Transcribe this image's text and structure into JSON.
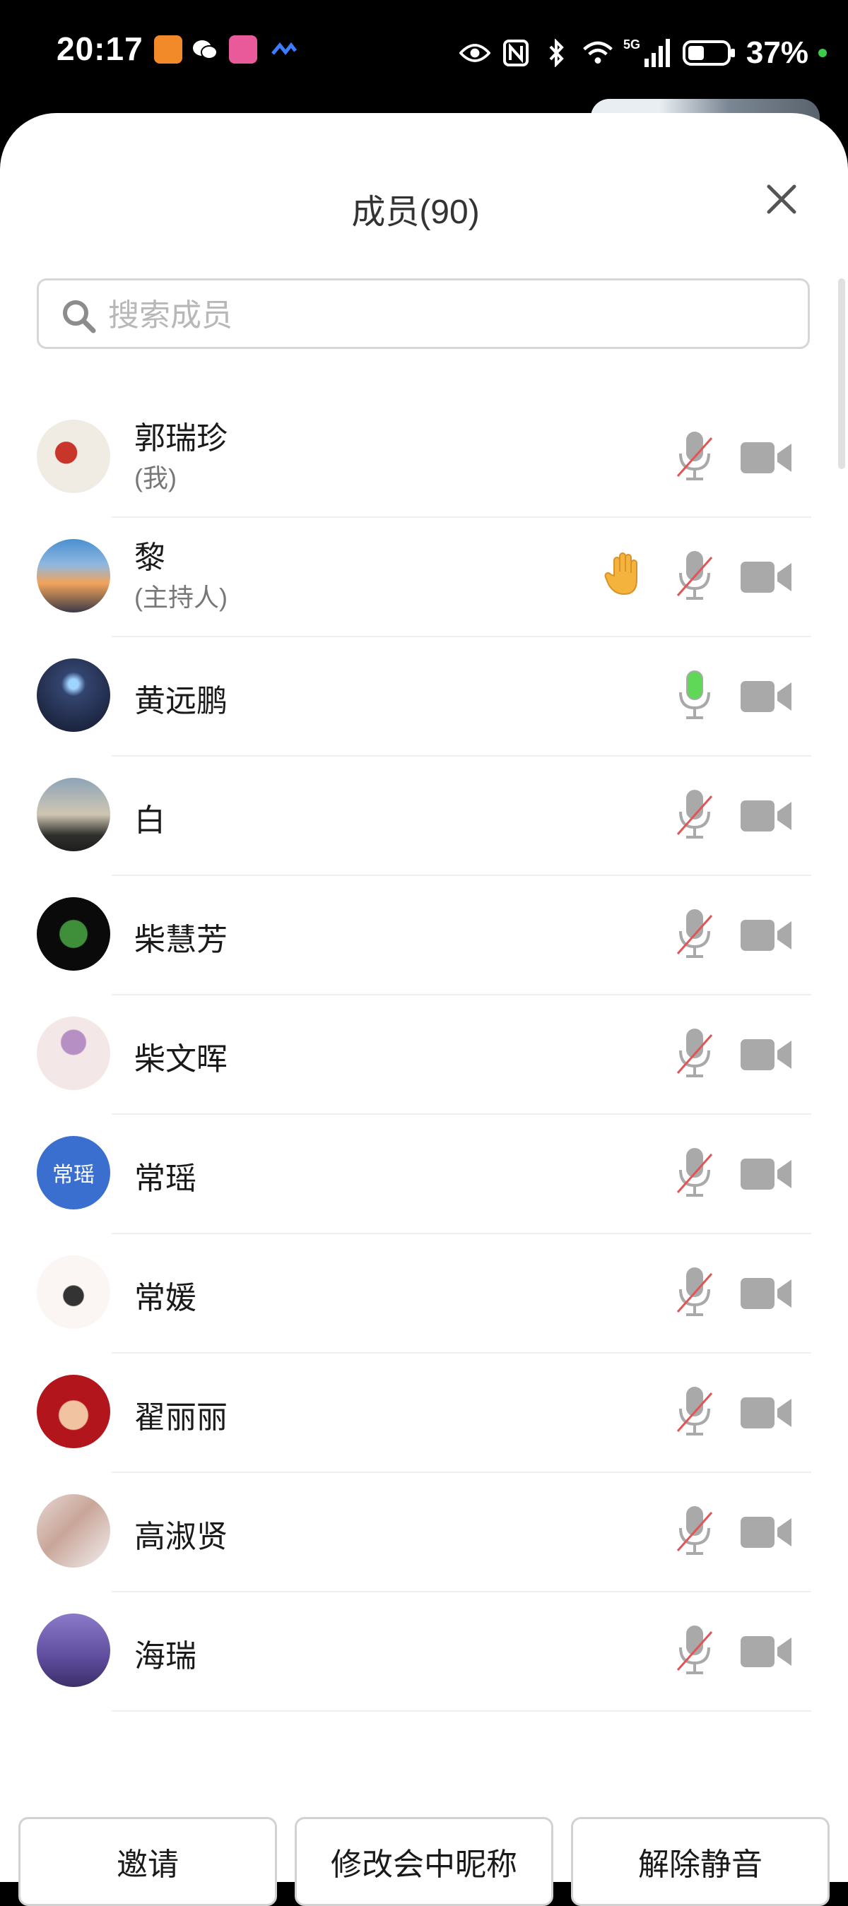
{
  "status_bar": {
    "time": "20:17",
    "network": "5G",
    "battery": "37%"
  },
  "header": {
    "title": "成员(90)"
  },
  "search": {
    "placeholder": "搜索成员"
  },
  "members": [
    {
      "name": "郭瑞珍",
      "role": "(我)",
      "mic": "muted",
      "hand_raised": false,
      "avatar": "photo-child"
    },
    {
      "name": "黎",
      "role": "(主持人)",
      "mic": "muted",
      "hand_raised": true,
      "avatar": "photo-sunset"
    },
    {
      "name": "黄远鹏",
      "role": "",
      "mic": "active",
      "hand_raised": false,
      "avatar": "photo-night"
    },
    {
      "name": "白",
      "role": "",
      "mic": "muted",
      "hand_raised": false,
      "avatar": "photo-dusk"
    },
    {
      "name": "柴慧芳",
      "role": "",
      "mic": "muted",
      "hand_raised": false,
      "avatar": "photo-leaf"
    },
    {
      "name": "柴文晖",
      "role": "",
      "mic": "muted",
      "hand_raised": false,
      "avatar": "photo-flowers"
    },
    {
      "name": "常瑶",
      "role": "",
      "mic": "muted",
      "hand_raised": false,
      "avatar": "text",
      "avatar_text": "常瑶"
    },
    {
      "name": "常媛",
      "role": "",
      "mic": "muted",
      "hand_raised": false,
      "avatar": "photo-cartoon"
    },
    {
      "name": "翟丽丽",
      "role": "",
      "mic": "muted",
      "hand_raised": false,
      "avatar": "photo-red"
    },
    {
      "name": "高淑贤",
      "role": "",
      "mic": "muted",
      "hand_raised": false,
      "avatar": "photo-selfie"
    },
    {
      "name": "海瑞",
      "role": "",
      "mic": "muted",
      "hand_raised": false,
      "avatar": "photo-lavender"
    }
  ],
  "actions": {
    "invite": "邀请",
    "rename": "修改会中昵称",
    "unmute": "解除静音"
  },
  "colors": {
    "mic_active": "#5fd858",
    "mute_slash": "#e05555",
    "icon_gray": "#a9a9a9",
    "hand": "#f3b33d",
    "avatar_text_bg": "#3a6fd0"
  }
}
